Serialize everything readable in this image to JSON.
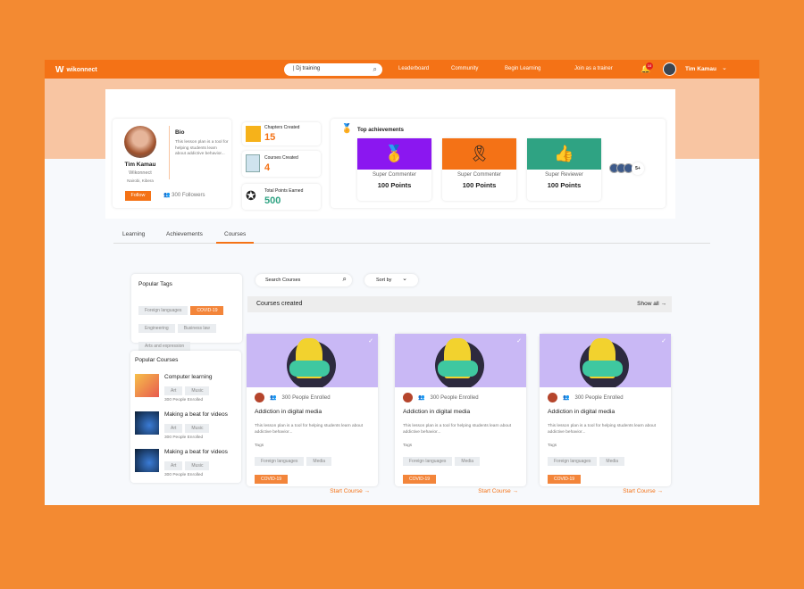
{
  "header": {
    "logo": "wikonnect",
    "search_value": "| Dj training",
    "nav": [
      "Leaderboard",
      "Community",
      "Begin Learning",
      "Join as a trainer"
    ],
    "notifications": "10",
    "user": "Tim Kamau"
  },
  "profile": {
    "name": "Tim Kamau",
    "org": "Wikonnect",
    "location": "Nairobi, Kibera",
    "follow": "Follow",
    "followers": "300 Followers",
    "bio_title": "Bio",
    "bio": "This lesson plan is a tool for helping students learn about addictive behavior..."
  },
  "stats": [
    {
      "label": "Chapters Created",
      "value": "15"
    },
    {
      "label": "Courses Created",
      "value": "4"
    },
    {
      "label": "Total Points Earned",
      "value": "500"
    }
  ],
  "achievements": {
    "title": "Top achievements",
    "items": [
      {
        "label": "Super Commenter",
        "points": "100 Points",
        "color": "#8B17F0"
      },
      {
        "label": "Super Commenter",
        "points": "100 Points",
        "color": "#F47216"
      },
      {
        "label": "Super Reviewer",
        "points": "100 Points",
        "color": "#2FA383"
      }
    ],
    "more": "5+"
  },
  "tabs": [
    "Learning",
    "Achievements",
    "Courses"
  ],
  "popular_tags": {
    "title": "Popular Tags",
    "tags": [
      "Foreign languages",
      "COVID-19",
      "Engineering",
      "Business law",
      "Arts and expression"
    ]
  },
  "popular_courses": {
    "title": "Popular Courses",
    "items": [
      {
        "title": "Computer learning",
        "tags": [
          "Art",
          "Music"
        ],
        "enrolled": "300 People Enrolled"
      },
      {
        "title": "Making a beat for videos",
        "tags": [
          "Art",
          "Music"
        ],
        "enrolled": "300 People Enrolled"
      },
      {
        "title": "Making a beat for videos",
        "tags": [
          "Art",
          "Music"
        ],
        "enrolled": "300 People Enrolled"
      }
    ]
  },
  "courses": {
    "search_placeholder": "Search Courses",
    "sort": "Sort by",
    "section_title": "Courses created",
    "show_all": "Show all →",
    "cards": [
      {
        "enrolled": "300 People Enrolled",
        "title": "Addiction in digital media",
        "desc": "This lesson plan is a tool for helping students learn about addictive behavior...",
        "tags_label": "Tags",
        "tags": [
          "Foreign languages",
          "Media",
          "COVID-19"
        ],
        "cta": "Start Course →"
      },
      {
        "enrolled": "300 People Enrolled",
        "title": "Addiction in digital media",
        "desc": "This lesson plan is a tool for helping students learn about addictive behavior...",
        "tags_label": "Tags",
        "tags": [
          "Foreign languages",
          "Media",
          "COVID-19"
        ],
        "cta": "Start Course →"
      },
      {
        "enrolled": "300 People Enrolled",
        "title": "Addiction in digital media",
        "desc": "This lesson plan is a tool for helping students learn about addictive behavior...",
        "tags_label": "Tags",
        "tags": [
          "Foreign languages",
          "Media",
          "COVID-19"
        ],
        "cta": "Start Course →"
      }
    ]
  }
}
